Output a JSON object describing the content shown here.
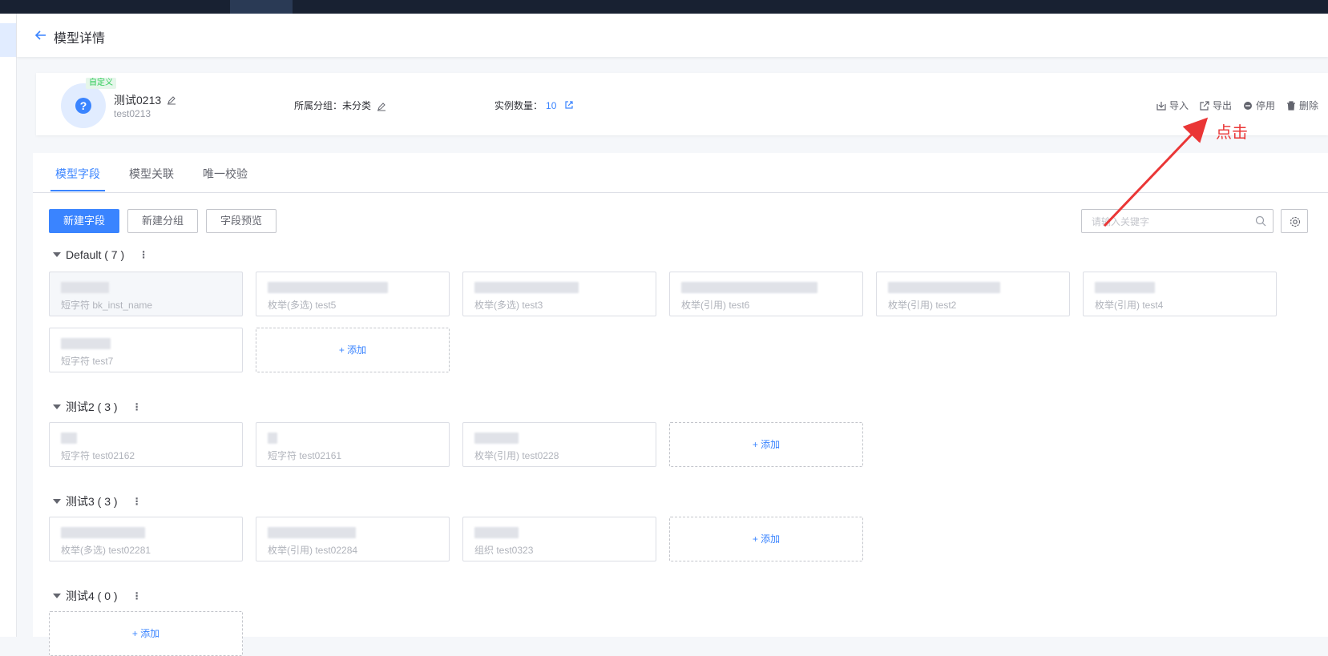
{
  "header": {
    "title": "模型详情"
  },
  "model": {
    "badge": "自定义",
    "name": "测试0213",
    "id": "test0213",
    "group_label": "所属分组：",
    "group_value": "未分类",
    "count_label": "实例数量：",
    "count_value": "10"
  },
  "actions": {
    "import": "导入",
    "export": "导出",
    "disable": "停用",
    "delete": "删除"
  },
  "annotation": {
    "text": "点击"
  },
  "tabs": [
    {
      "label": "模型字段"
    },
    {
      "label": "模型关联"
    },
    {
      "label": "唯一校验"
    }
  ],
  "toolbar": {
    "new_field": "新建字段",
    "new_group": "新建分组",
    "preview": "字段预览",
    "search_placeholder": "请输入关键字"
  },
  "add_label": "+ 添加",
  "groups": [
    {
      "title": "Default ( 7 )",
      "fields": [
        {
          "meta": "短字符  bk_inst_name"
        },
        {
          "meta": "枚举(多选)  test5"
        },
        {
          "meta": "枚举(多选)  test3"
        },
        {
          "meta": "枚举(引用)  test6"
        },
        {
          "meta": "枚举(引用)  test2"
        },
        {
          "meta": "枚举(引用)  test4"
        },
        {
          "meta": "短字符  test7"
        }
      ]
    },
    {
      "title": "测试2 ( 3 )",
      "fields": [
        {
          "meta": "短字符  test02162"
        },
        {
          "meta": "短字符  test02161"
        },
        {
          "meta": "枚举(引用)  test0228"
        }
      ]
    },
    {
      "title": "测试3 ( 3 )",
      "fields": [
        {
          "meta": "枚举(多选)  test02281"
        },
        {
          "meta": "枚举(引用)  test02284"
        },
        {
          "meta": "组织  test0323"
        }
      ]
    },
    {
      "title": "测试4 ( 0 )",
      "fields": []
    }
  ],
  "colors": {
    "primary": "#3a84ff",
    "annotation": "#ea3636",
    "badge": "#2dcb56"
  }
}
